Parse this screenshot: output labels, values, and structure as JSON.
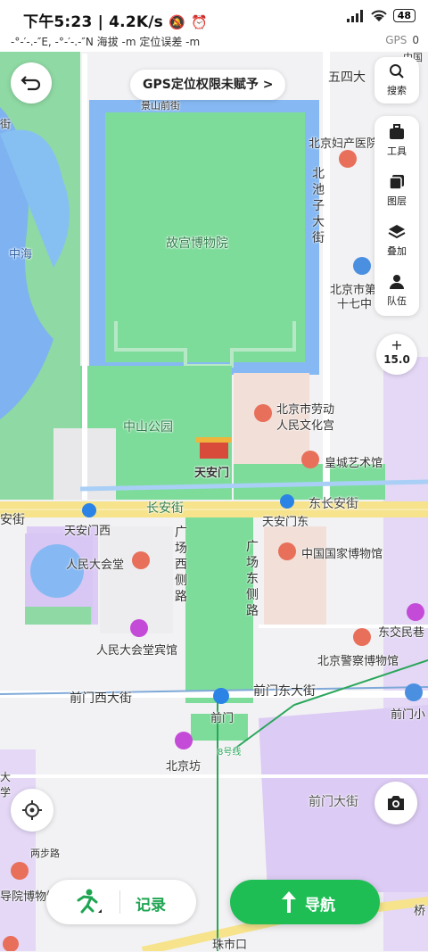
{
  "status_bar": {
    "time": "下午5:23",
    "speed": "4.2K/s",
    "battery": "48",
    "gps_line": "-°-′-.-″E, -°-′-.-″N  海拔 -m   定位误差 -m",
    "gps_label": "GPS",
    "gps_count": "0"
  },
  "gps_banner": {
    "text": "GPS定位权限未赋予 >"
  },
  "side_panel": {
    "search_label": "搜索",
    "tools_label": "工具",
    "layers_label": "图层",
    "overlay_label": "叠加",
    "team_label": "队伍"
  },
  "zoom": {
    "plus": "+",
    "minus": "—",
    "level": "15.0"
  },
  "bottom": {
    "record_label": "记录",
    "navigate_label": "导航"
  },
  "map_labels": {
    "palace": "故宫博物院",
    "zhonghai": "中海",
    "zhongshan_park": "中山公园",
    "tiananmen": "天安门",
    "workers_palace_l1": "北京市劳动",
    "workers_palace_l2": "人民文化宫",
    "huangcheng": "皇城艺术馆",
    "changan_w": "长安街",
    "changan_e": "东长安街",
    "tiananmen_west": "天安门西",
    "tiananmen_east": "天安门东",
    "great_hall": "人民大会堂",
    "national_museum": "中国国家博物馆",
    "guangchang_w": "广场西侧路",
    "guangchang_e": "广场东侧路",
    "great_hall_hotel": "人民大会堂宾馆",
    "dongjiaomin": "东交民巷",
    "police_museum": "北京警察博物馆",
    "qianmen_west": "前门西大街",
    "qianmen_east": "前门东大街",
    "qianmen": "前门",
    "qianmen_xiao": "前门小",
    "beijingfang": "北京坊",
    "line8": "8号线",
    "qianmen_dajie": "前门大街",
    "liangbulu": "两步路",
    "museum_left": "导院博物馆",
    "zhushikou": "珠市口",
    "qiao": "桥",
    "wusi": "五四大",
    "jingshan_q": "景山前街",
    "fuchan": "北京妇产医院",
    "beichizi": "北池子大街",
    "school_l1": "北京市第",
    "school_l2": "十七中",
    "an_jie": "安街",
    "zhongguo": "中国",
    "da_xue": "大学",
    "top_left": "街"
  },
  "colors": {
    "accent_green": "#1fbe55",
    "park_green": "#7ddc9a",
    "water_blue": "#86b9f3",
    "road_yellow": "#f6e38c"
  }
}
